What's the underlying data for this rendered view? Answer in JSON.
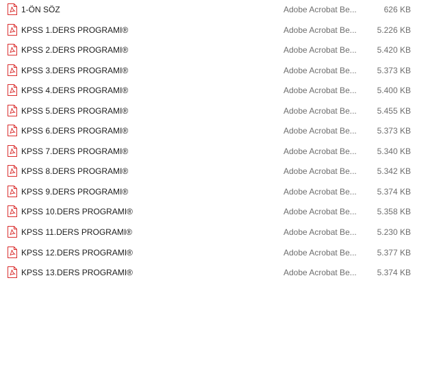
{
  "file_list": {
    "icon": "pdf-file-icon",
    "accent_color": "#d92b2b",
    "rows": [
      {
        "name": "1-ÖN SÖZ",
        "type": "Adobe Acrobat Be...",
        "size": "626 KB"
      },
      {
        "name": "KPSS 1.DERS PROGRAMI®",
        "type": "Adobe Acrobat Be...",
        "size": "5.226 KB"
      },
      {
        "name": "KPSS 2.DERS PROGRAMI®",
        "type": "Adobe Acrobat Be...",
        "size": "5.420 KB"
      },
      {
        "name": "KPSS 3.DERS PROGRAMI®",
        "type": "Adobe Acrobat Be...",
        "size": "5.373 KB"
      },
      {
        "name": "KPSS 4.DERS PROGRAMI®",
        "type": "Adobe Acrobat Be...",
        "size": "5.400 KB"
      },
      {
        "name": "KPSS 5.DERS PROGRAMI®",
        "type": "Adobe Acrobat Be...",
        "size": "5.455 KB"
      },
      {
        "name": "KPSS 6.DERS PROGRAMI®",
        "type": "Adobe Acrobat Be...",
        "size": "5.373 KB"
      },
      {
        "name": "KPSS 7.DERS PROGRAMI®",
        "type": "Adobe Acrobat Be...",
        "size": "5.340 KB"
      },
      {
        "name": "KPSS 8.DERS PROGRAMI®",
        "type": "Adobe Acrobat Be...",
        "size": "5.342 KB"
      },
      {
        "name": "KPSS 9.DERS PROGRAMI®",
        "type": "Adobe Acrobat Be...",
        "size": "5.374 KB"
      },
      {
        "name": "KPSS 10.DERS PROGRAMI®",
        "type": "Adobe Acrobat Be...",
        "size": "5.358 KB"
      },
      {
        "name": "KPSS 11.DERS PROGRAMI®",
        "type": "Adobe Acrobat Be...",
        "size": "5.230 KB"
      },
      {
        "name": "KPSS 12.DERS PROGRAMI®",
        "type": "Adobe Acrobat Be...",
        "size": "5.377 KB"
      },
      {
        "name": "KPSS 13.DERS PROGRAMI®",
        "type": "Adobe Acrobat Be...",
        "size": "5.374 KB"
      }
    ]
  }
}
